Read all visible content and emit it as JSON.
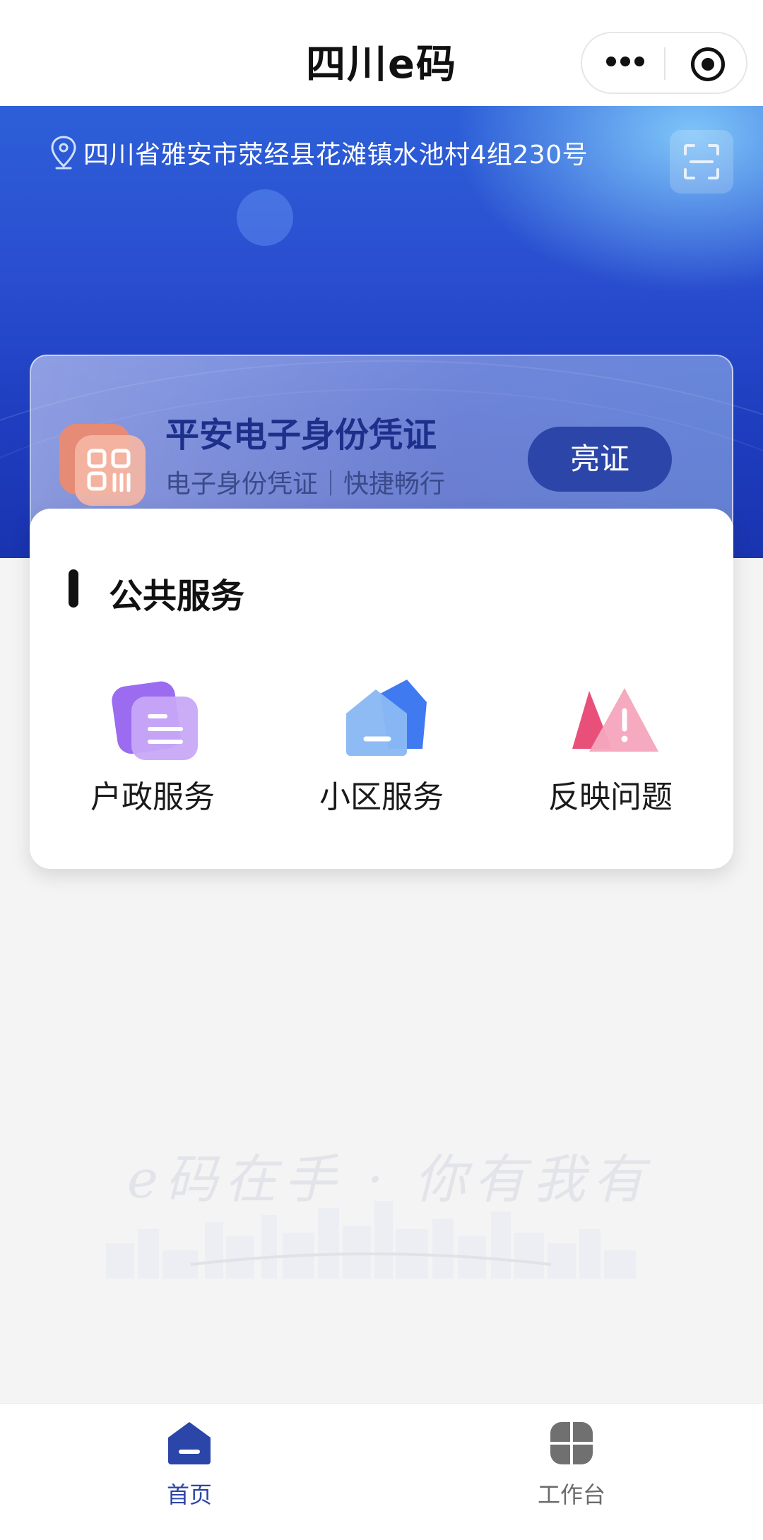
{
  "app": {
    "title": "四川e码"
  },
  "capsule": {
    "more_icon": "more-dots-icon",
    "close_icon": "target-icon"
  },
  "hero": {
    "address": "四川省雅安市荥经县花滩镇水池村4组230号",
    "scan_icon": "scan-icon"
  },
  "credential": {
    "title": "平安电子身份凭证",
    "subtitle": "电子身份凭证｜快捷畅行",
    "button": "亮证"
  },
  "services": {
    "title": "公共服务",
    "items": [
      {
        "label": "户政服务",
        "icon": "household-doc-icon"
      },
      {
        "label": "小区服务",
        "icon": "community-house-icon"
      },
      {
        "label": "反映问题",
        "icon": "warning-icon"
      }
    ]
  },
  "slogan": "e码在手 · 你有我有",
  "tabs": [
    {
      "label": "首页",
      "icon": "home-icon",
      "active": true
    },
    {
      "label": "工作台",
      "icon": "workbench-icon",
      "active": false
    }
  ],
  "colors": {
    "primary": "#2b45a8",
    "tab_active": "#2b45a8",
    "tab_inactive": "#6b6b6b"
  }
}
